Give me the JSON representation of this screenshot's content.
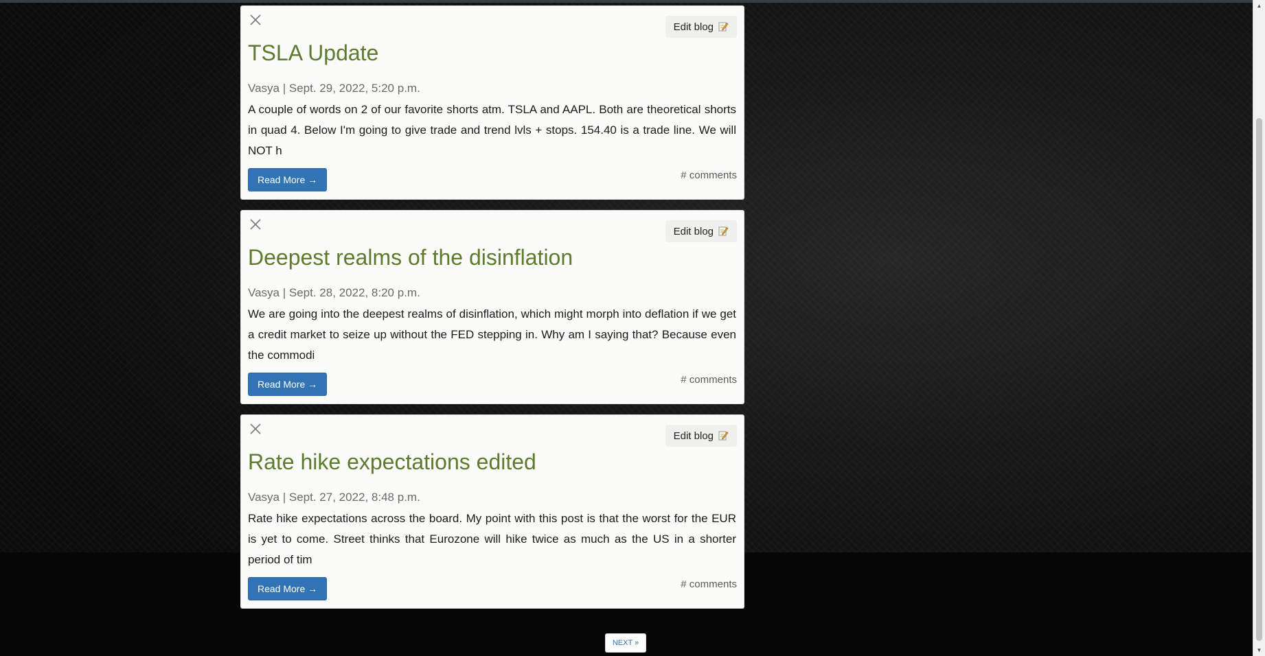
{
  "posts": [
    {
      "title": "TSLA Update",
      "author": "Vasya",
      "separator": "|",
      "date": "Sept. 29, 2022, 5:20 p.m.",
      "excerpt": "A couple of words on 2 of our favorite shorts atm. TSLA and AAPL. Both are theoretical shorts in quad 4. Below I'm going to give trade and trend lvls + stops. 154.40 is a trade line. We will NOT h",
      "edit_label": "Edit blog",
      "read_more_label": "Read More →",
      "comments_label": "# comments"
    },
    {
      "title": "Deepest realms of the disinflation",
      "author": "Vasya",
      "separator": "|",
      "date": "Sept. 28, 2022, 8:20 p.m.",
      "excerpt": "We are going into the deepest realms of disinflation, which might morph into deflation if we get a credit market to seize up without the FED stepping in. Why am I saying that? Because even the commodi",
      "edit_label": "Edit blog",
      "read_more_label": "Read More →",
      "comments_label": "# comments"
    },
    {
      "title": "Rate hike expectations edited",
      "author": "Vasya",
      "separator": "|",
      "date": "Sept. 27, 2022, 8:48 p.m.",
      "excerpt": "Rate hike expectations across the board. My point with this post is that the worst for the EUR is yet to come. Street thinks that Eurozone will hike twice as much as the US in a shorter period of tim",
      "edit_label": "Edit blog",
      "read_more_label": "Read More →",
      "comments_label": "# comments"
    }
  ],
  "pagination": {
    "next_label": "NEXT »"
  },
  "icons": {
    "close": "close-icon",
    "edit": "memo-pencil-icon"
  },
  "colors": {
    "title": "#5d7a2e",
    "read_more_bg": "#3173b3",
    "card_bg": "#fbfbf9",
    "page_bg": "#0b0b0b"
  }
}
